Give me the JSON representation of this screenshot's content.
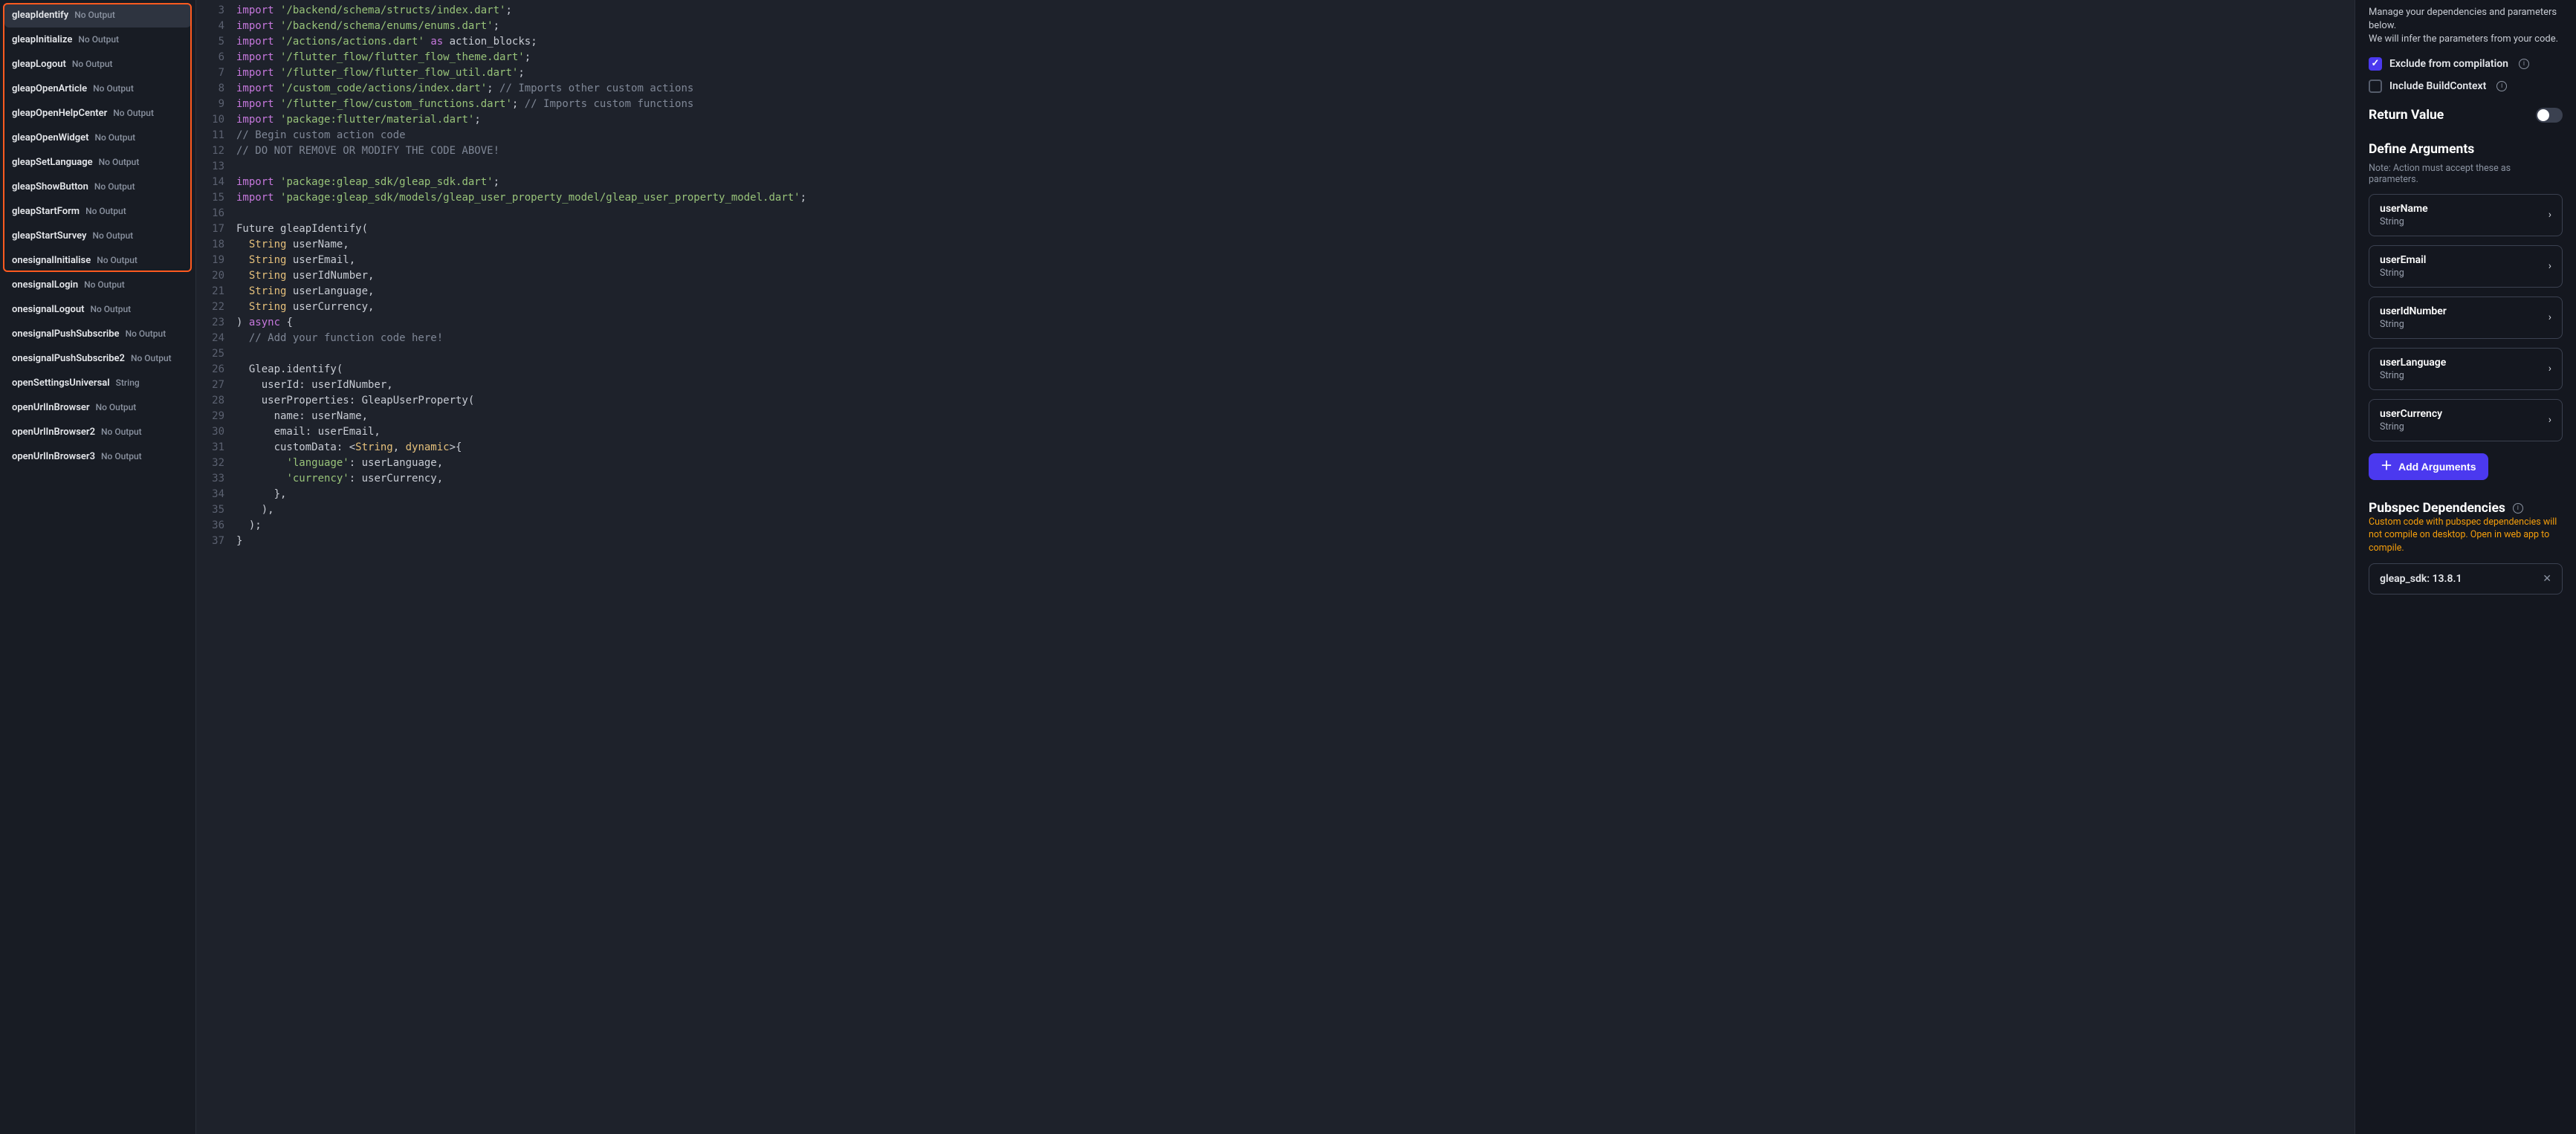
{
  "sidebar": {
    "items": [
      {
        "name": "gleapIdentify",
        "sub": "No Output",
        "selected": true
      },
      {
        "name": "gleapInitialize",
        "sub": "No Output"
      },
      {
        "name": "gleapLogout",
        "sub": "No Output"
      },
      {
        "name": "gleapOpenArticle",
        "sub": "No Output"
      },
      {
        "name": "gleapOpenHelpCenter",
        "sub": "No Output"
      },
      {
        "name": "gleapOpenWidget",
        "sub": "No Output"
      },
      {
        "name": "gleapSetLanguage",
        "sub": "No Output"
      },
      {
        "name": "gleapShowButton",
        "sub": "No Output"
      },
      {
        "name": "gleapStartForm",
        "sub": "No Output"
      },
      {
        "name": "gleapStartSurvey",
        "sub": "No Output"
      },
      {
        "name": "onesignalInitialise",
        "sub": "No Output"
      },
      {
        "name": "onesignalLogin",
        "sub": "No Output"
      },
      {
        "name": "onesignalLogout",
        "sub": "No Output"
      },
      {
        "name": "onesignalPushSubscribe",
        "sub": "No Output"
      },
      {
        "name": "onesignalPushSubscribe2",
        "sub": "No Output"
      },
      {
        "name": "openSettingsUniversal",
        "sub": "String"
      },
      {
        "name": "openUrlInBrowser",
        "sub": "No Output"
      },
      {
        "name": "openUrlInBrowser2",
        "sub": "No Output"
      },
      {
        "name": "openUrlInBrowser3",
        "sub": "No Output"
      }
    ]
  },
  "code": {
    "lines": [
      {
        "n": 3,
        "tokens": [
          [
            "kw",
            "import"
          ],
          [
            "pln",
            " "
          ],
          [
            "str",
            "'/backend/schema/structs/index.dart'"
          ],
          [
            "pln",
            ";"
          ]
        ]
      },
      {
        "n": 4,
        "tokens": [
          [
            "kw",
            "import"
          ],
          [
            "pln",
            " "
          ],
          [
            "str",
            "'/backend/schema/enums/enums.dart'"
          ],
          [
            "pln",
            ";"
          ]
        ]
      },
      {
        "n": 5,
        "tokens": [
          [
            "kw",
            "import"
          ],
          [
            "pln",
            " "
          ],
          [
            "str",
            "'/actions/actions.dart'"
          ],
          [
            "pln",
            " "
          ],
          [
            "kw",
            "as"
          ],
          [
            "pln",
            " action_blocks;"
          ]
        ]
      },
      {
        "n": 6,
        "tokens": [
          [
            "kw",
            "import"
          ],
          [
            "pln",
            " "
          ],
          [
            "str",
            "'/flutter_flow/flutter_flow_theme.dart'"
          ],
          [
            "pln",
            ";"
          ]
        ]
      },
      {
        "n": 7,
        "tokens": [
          [
            "kw",
            "import"
          ],
          [
            "pln",
            " "
          ],
          [
            "str",
            "'/flutter_flow/flutter_flow_util.dart'"
          ],
          [
            "pln",
            ";"
          ]
        ]
      },
      {
        "n": 8,
        "tokens": [
          [
            "kw",
            "import"
          ],
          [
            "pln",
            " "
          ],
          [
            "str",
            "'/custom_code/actions/index.dart'"
          ],
          [
            "pln",
            "; "
          ],
          [
            "cmt",
            "// Imports other custom actions"
          ]
        ]
      },
      {
        "n": 9,
        "tokens": [
          [
            "kw",
            "import"
          ],
          [
            "pln",
            " "
          ],
          [
            "str",
            "'/flutter_flow/custom_functions.dart'"
          ],
          [
            "pln",
            "; "
          ],
          [
            "cmt",
            "// Imports custom functions"
          ]
        ]
      },
      {
        "n": 10,
        "tokens": [
          [
            "kw",
            "import"
          ],
          [
            "pln",
            " "
          ],
          [
            "str",
            "'package:flutter/material.dart'"
          ],
          [
            "pln",
            ";"
          ]
        ]
      },
      {
        "n": 11,
        "tokens": [
          [
            "cmt",
            "// Begin custom action code"
          ]
        ]
      },
      {
        "n": 12,
        "tokens": [
          [
            "cmt",
            "// DO NOT REMOVE OR MODIFY THE CODE ABOVE!"
          ]
        ]
      },
      {
        "n": 13,
        "tokens": [
          [
            "pln",
            ""
          ]
        ]
      },
      {
        "n": 14,
        "tokens": [
          [
            "kw",
            "import"
          ],
          [
            "pln",
            " "
          ],
          [
            "str",
            "'package:gleap_sdk/gleap_sdk.dart'"
          ],
          [
            "pln",
            ";"
          ]
        ]
      },
      {
        "n": 15,
        "tokens": [
          [
            "kw",
            "import"
          ],
          [
            "pln",
            " "
          ],
          [
            "str",
            "'package:gleap_sdk/models/gleap_user_property_model/gleap_user_property_model.dart'"
          ],
          [
            "pln",
            ";"
          ]
        ]
      },
      {
        "n": 16,
        "tokens": [
          [
            "pln",
            ""
          ]
        ]
      },
      {
        "n": 17,
        "tokens": [
          [
            "pln",
            "Future gleapIdentify("
          ]
        ]
      },
      {
        "n": 18,
        "tokens": [
          [
            "pln",
            "  "
          ],
          [
            "type",
            "String"
          ],
          [
            "pln",
            " userName,"
          ]
        ]
      },
      {
        "n": 19,
        "tokens": [
          [
            "pln",
            "  "
          ],
          [
            "type",
            "String"
          ],
          [
            "pln",
            " userEmail,"
          ]
        ]
      },
      {
        "n": 20,
        "tokens": [
          [
            "pln",
            "  "
          ],
          [
            "type",
            "String"
          ],
          [
            "pln",
            " userIdNumber,"
          ]
        ]
      },
      {
        "n": 21,
        "tokens": [
          [
            "pln",
            "  "
          ],
          [
            "type",
            "String"
          ],
          [
            "pln",
            " userLanguage,"
          ]
        ]
      },
      {
        "n": 22,
        "tokens": [
          [
            "pln",
            "  "
          ],
          [
            "type",
            "String"
          ],
          [
            "pln",
            " userCurrency,"
          ]
        ]
      },
      {
        "n": 23,
        "tokens": [
          [
            "pln",
            ") "
          ],
          [
            "kw",
            "async"
          ],
          [
            "pln",
            " {"
          ]
        ]
      },
      {
        "n": 24,
        "tokens": [
          [
            "pln",
            "  "
          ],
          [
            "cmt",
            "// Add your function code here!"
          ]
        ]
      },
      {
        "n": 25,
        "tokens": [
          [
            "pln",
            ""
          ]
        ]
      },
      {
        "n": 26,
        "tokens": [
          [
            "pln",
            "  Gleap.identify("
          ]
        ]
      },
      {
        "n": 27,
        "tokens": [
          [
            "pln",
            "    userId: userIdNumber,"
          ]
        ]
      },
      {
        "n": 28,
        "tokens": [
          [
            "pln",
            "    userProperties: GleapUserProperty("
          ]
        ]
      },
      {
        "n": 29,
        "tokens": [
          [
            "pln",
            "      name: userName,"
          ]
        ]
      },
      {
        "n": 30,
        "tokens": [
          [
            "pln",
            "      email: userEmail,"
          ]
        ]
      },
      {
        "n": 31,
        "tokens": [
          [
            "pln",
            "      customData: <"
          ],
          [
            "type",
            "String"
          ],
          [
            "pln",
            ", "
          ],
          [
            "type",
            "dynamic"
          ],
          [
            "pln",
            ">{"
          ]
        ]
      },
      {
        "n": 32,
        "tokens": [
          [
            "pln",
            "        "
          ],
          [
            "str",
            "'language'"
          ],
          [
            "pln",
            ": userLanguage,"
          ]
        ]
      },
      {
        "n": 33,
        "tokens": [
          [
            "pln",
            "        "
          ],
          [
            "str",
            "'currency'"
          ],
          [
            "pln",
            ": userCurrency,"
          ]
        ]
      },
      {
        "n": 34,
        "tokens": [
          [
            "pln",
            "      },"
          ]
        ]
      },
      {
        "n": 35,
        "tokens": [
          [
            "pln",
            "    ),"
          ]
        ]
      },
      {
        "n": 36,
        "tokens": [
          [
            "pln",
            "  );"
          ]
        ]
      },
      {
        "n": 37,
        "tokens": [
          [
            "pln",
            "}"
          ]
        ]
      }
    ]
  },
  "panel": {
    "desc1": "Manage your dependencies and parameters below.",
    "desc2": "We will infer the parameters from your code.",
    "exclude_label": "Exclude from compilation",
    "include_label": "Include BuildContext",
    "return_value_label": "Return Value",
    "define_args_label": "Define Arguments",
    "define_args_note": "Note: Action must accept these as parameters.",
    "args": [
      {
        "name": "userName",
        "type": "String"
      },
      {
        "name": "userEmail",
        "type": "String"
      },
      {
        "name": "userIdNumber",
        "type": "String"
      },
      {
        "name": "userLanguage",
        "type": "String"
      },
      {
        "name": "userCurrency",
        "type": "String"
      }
    ],
    "add_args_label": "Add Arguments",
    "pubspec_label": "Pubspec Dependencies",
    "pubspec_warn": "Custom code with pubspec dependencies will not compile on desktop. Open in web app to compile.",
    "deps": [
      "gleap_sdk: 13.8.1"
    ]
  }
}
